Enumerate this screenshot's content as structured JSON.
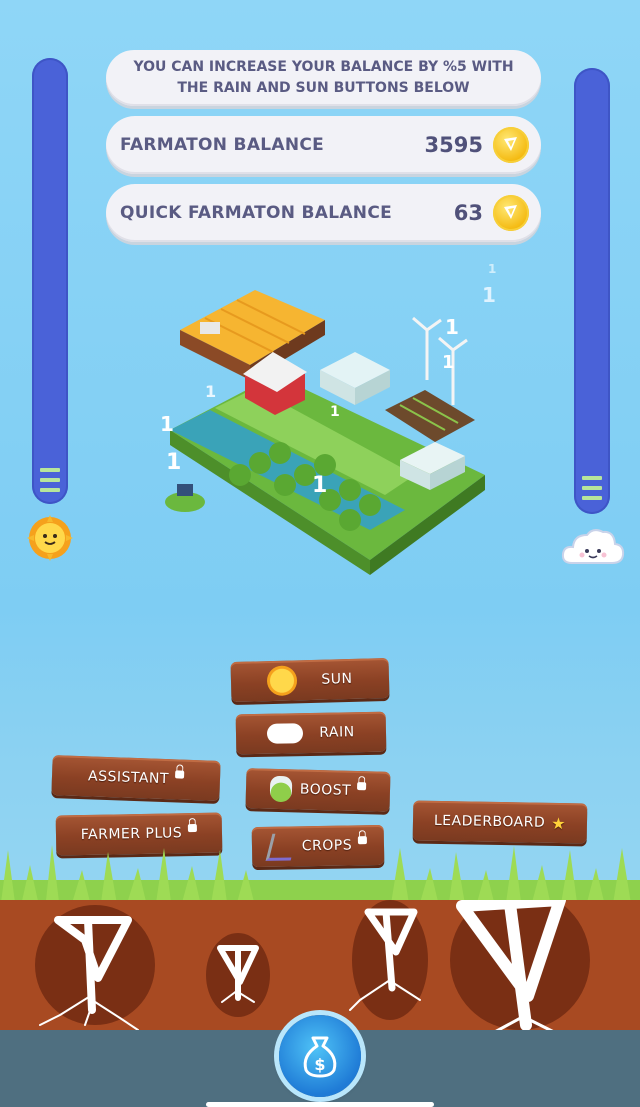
{
  "header": {
    "info_text": "YOU CAN INCREASE YOUR BALANCE BY %5 WITH THE RAIN AND SUN BUTTONS BELOW",
    "balance_label": "FARMATON BALANCE",
    "balance_value": "3595",
    "quick_balance_label": "QUICK FARMATON BALANCE",
    "quick_balance_value": "63"
  },
  "farm": {
    "floating_numbers": [
      "1",
      "1",
      "1",
      "1",
      "1",
      "1",
      "1",
      "1",
      "1"
    ]
  },
  "gauges": {
    "sun_icon": "sun-icon",
    "rain_icon": "cloud-icon"
  },
  "menu": {
    "sun": "SUN",
    "rain": "RAIN",
    "assistant": "ASSISTANT",
    "boost": "BOOST",
    "farmer_plus": "FARMER PLUS",
    "crops": "CROPS",
    "leaderboard": "LEADERBOARD"
  },
  "bottom": {
    "money_icon": "money-bag-icon"
  },
  "colors": {
    "sky": "#8fd6f7",
    "gauge": "#4a62d8",
    "wood": "#8b4124",
    "coin": "#f4b90f",
    "soil": "#a84a22"
  }
}
